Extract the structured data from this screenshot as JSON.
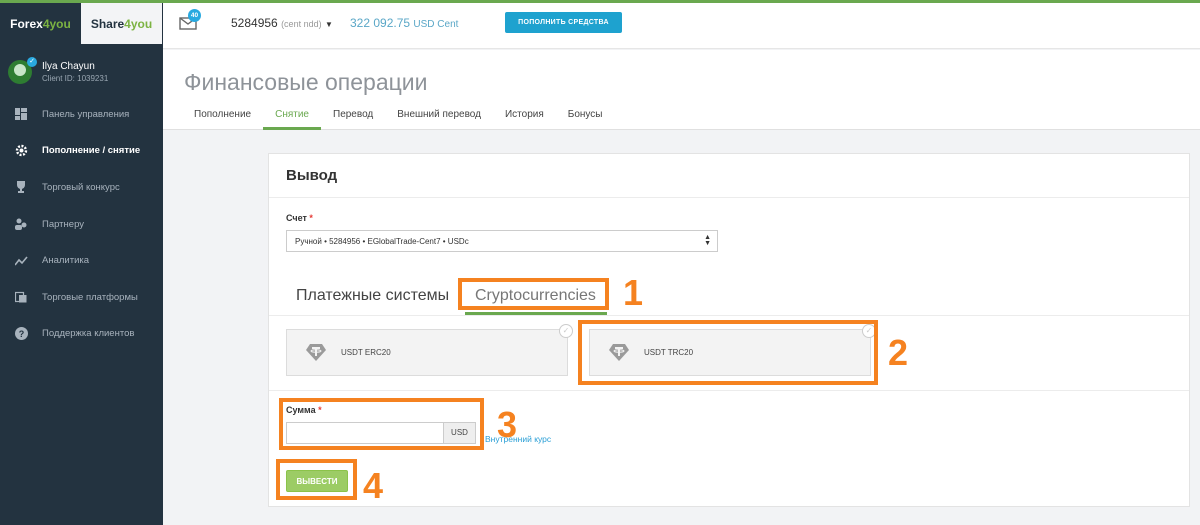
{
  "brand": {
    "forex_pre": "Forex",
    "forex_acc": "4you",
    "share_pre": "Share",
    "share_acc": "4you"
  },
  "user": {
    "name": "Ilya Chayun",
    "client_id": "Client ID: 1039231"
  },
  "nav": [
    {
      "label": "Панель управления",
      "icon": "dashboard-icon"
    },
    {
      "label": "Пополнение / снятие",
      "icon": "gear-icon",
      "active": true
    },
    {
      "label": "Торговый конкурс",
      "icon": "trophy-icon"
    },
    {
      "label": "Партнеру",
      "icon": "partner-icon"
    },
    {
      "label": "Аналитика",
      "icon": "chart-line-icon"
    },
    {
      "label": "Торговые платформы",
      "icon": "platforms-icon"
    },
    {
      "label": "Поддержка клиентов",
      "icon": "help-icon"
    }
  ],
  "topbar": {
    "mail_count": "40",
    "account_number": "5284956",
    "account_type": "(cent ndd)",
    "balance": "322 092.75",
    "balance_currency": "USD Cent",
    "deposit_button": "ПОПОЛНИТЬ СРЕДСТВА"
  },
  "page": {
    "title": "Финансовые операции",
    "tabs": [
      "Пополнение",
      "Снятие",
      "Перевод",
      "Внешний перевод",
      "История",
      "Бонусы"
    ],
    "active_tab": "Снятие"
  },
  "withdraw": {
    "title": "Вывод",
    "account_label": "Счет",
    "account_value": "Ручной • 5284956 • EGlobalTrade-Cent7 • USDc",
    "payment_tabs": [
      "Платежные системы",
      "Cryptocurrencies"
    ],
    "active_payment_tab": "Cryptocurrencies",
    "methods": [
      "USDT ERC20",
      "USDT TRC20"
    ],
    "amount_label": "Сумма",
    "amount_currency": "USD",
    "rate_link": "Внутренний курс",
    "submit_button": "ВЫВЕСТИ"
  },
  "annotations": {
    "color": "#f58220",
    "numbers": [
      "1",
      "2",
      "3",
      "4"
    ]
  }
}
